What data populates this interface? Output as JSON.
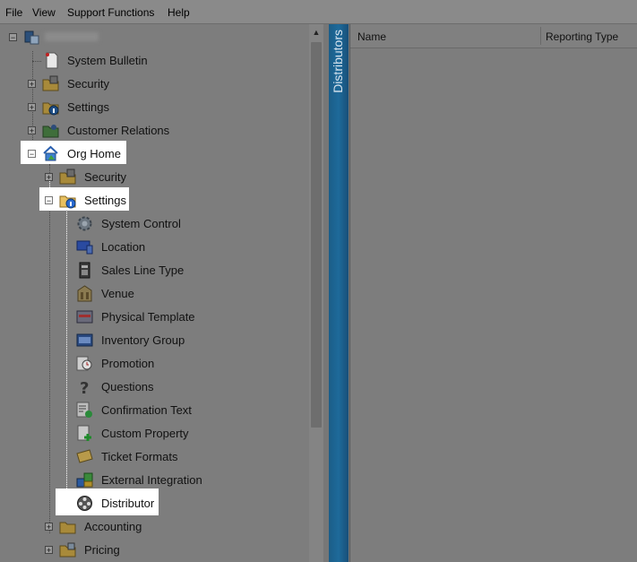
{
  "menu": {
    "file": "File",
    "view": "View",
    "support": "Support Functions",
    "help": "Help"
  },
  "tree": {
    "root_label": "",
    "system_bulletin": "System Bulletin",
    "security": "Security",
    "settings": "Settings",
    "customer_relations": "Customer Relations",
    "org_home": "Org Home",
    "org_security": "Security",
    "org_settings": "Settings",
    "settings_children": [
      "System Control",
      "Location",
      "Sales Line Type",
      "Venue",
      "Physical Template",
      "Inventory Group",
      "Promotion",
      "Questions",
      "Confirmation Text",
      "Custom Property",
      "Ticket Formats",
      "External Integration",
      "Distributor"
    ],
    "accounting": "Accounting",
    "pricing": "Pricing"
  },
  "side_tab": {
    "label": "Distributors"
  },
  "grid": {
    "columns": [
      "Name",
      "Reporting Type"
    ]
  }
}
